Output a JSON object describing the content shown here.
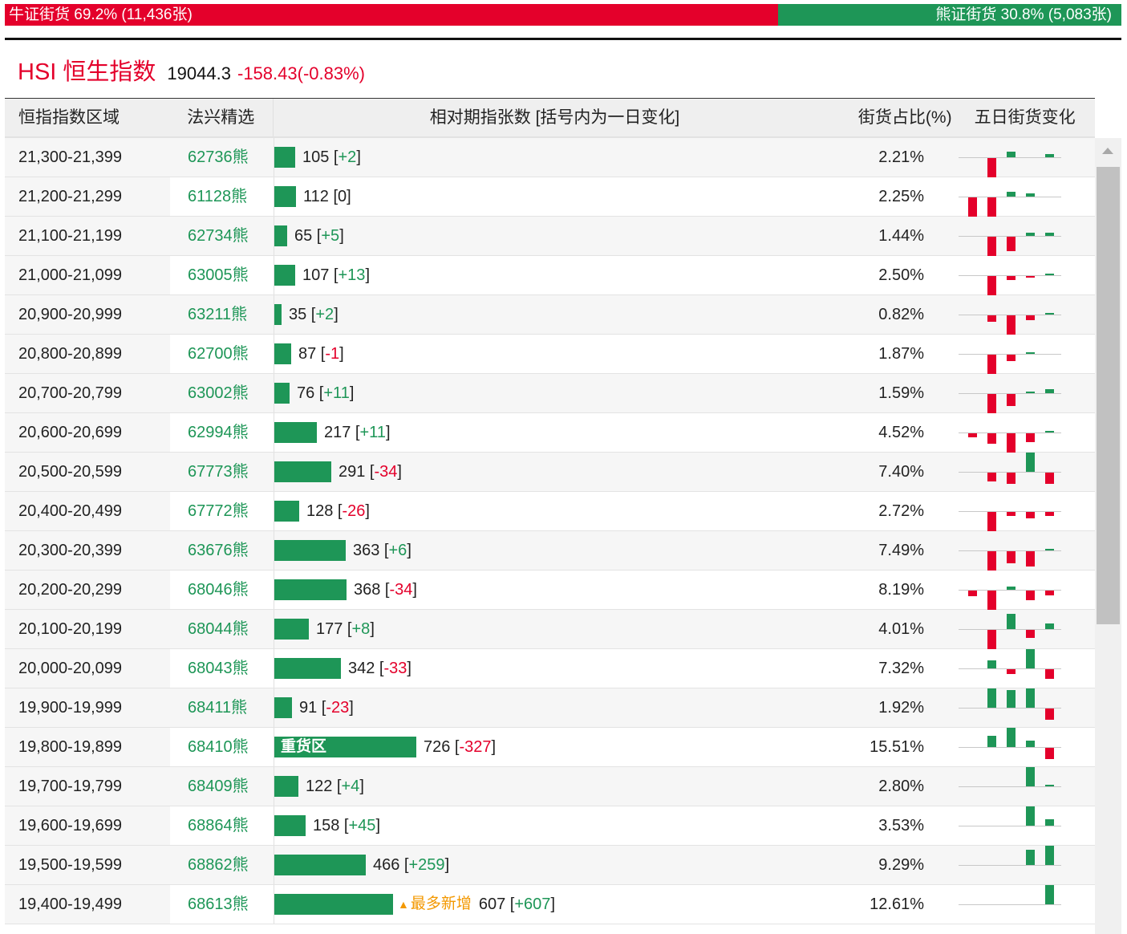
{
  "topbar": {
    "bull": "牛证街货 69.2% (11,436张)",
    "bear": "熊证街货 30.8% (5,083张)",
    "bull_pct": 69.2
  },
  "title": {
    "name": "HSI 恒生指数",
    "price": "19044.3",
    "change": "-158.43(-0.83%)"
  },
  "headers": [
    "恒指指数区域",
    "法兴精选",
    "相对期指张数 [括号内为一日变化]",
    "街货占比(%)",
    "五日街货变化"
  ],
  "max_count": 726,
  "colors": {
    "red": "#e4002b",
    "green": "#1e9657",
    "orange": "#f39800"
  },
  "rows": [
    {
      "range": "21,300-21,399",
      "code": "62736熊",
      "count": 105,
      "count_text": "105",
      "change": "+2",
      "pct": "2.21%",
      "five": [
        0,
        -1,
        0.3,
        0,
        0.15
      ]
    },
    {
      "range": "21,200-21,299",
      "code": "61128熊",
      "count": 112,
      "count_text": "112",
      "change": "0",
      "pct": "2.25%",
      "five": [
        -1,
        -1,
        0.25,
        0.15,
        0
      ]
    },
    {
      "range": "21,100-21,199",
      "code": "62734熊",
      "count": 65,
      "count_text": "65",
      "change": "+5",
      "pct": "1.44%",
      "five": [
        0,
        -1,
        -0.75,
        0.15,
        0.15
      ]
    },
    {
      "range": "21,000-21,099",
      "code": "63005熊",
      "count": 107,
      "count_text": "107",
      "change": "+13",
      "pct": "2.50%",
      "five": [
        0,
        -1,
        -0.2,
        -0.1,
        0.08
      ]
    },
    {
      "range": "20,900-20,999",
      "code": "63211熊",
      "count": 35,
      "count_text": "35",
      "change": "+2",
      "pct": "0.82%",
      "five": [
        0,
        -0.33,
        -1,
        -0.25,
        0.08
      ]
    },
    {
      "range": "20,800-20,899",
      "code": "62700熊",
      "count": 87,
      "count_text": "87",
      "change": "-1",
      "pct": "1.87%",
      "five": [
        0,
        -1,
        -0.33,
        0.08,
        0
      ]
    },
    {
      "range": "20,700-20,799",
      "code": "63002熊",
      "count": 76,
      "count_text": "76",
      "change": "+11",
      "pct": "1.59%",
      "five": [
        0,
        -1,
        -0.62,
        0.08,
        0.2
      ]
    },
    {
      "range": "20,600-20,699",
      "code": "62994熊",
      "count": 217,
      "count_text": "217",
      "change": "+11",
      "pct": "4.52%",
      "five": [
        -0.2,
        -0.55,
        -1,
        -0.45,
        0.08
      ]
    },
    {
      "range": "20,500-20,599",
      "code": "67773熊",
      "count": 291,
      "count_text": "291",
      "change": "-34",
      "pct": "7.40%",
      "five": [
        0,
        -0.45,
        -0.6,
        1,
        -0.6
      ]
    },
    {
      "range": "20,400-20,499",
      "code": "67772熊",
      "count": 128,
      "count_text": "128",
      "change": "-26",
      "pct": "2.72%",
      "five": [
        0,
        -1,
        -0.2,
        -0.33,
        -0.2
      ]
    },
    {
      "range": "20,300-20,399",
      "code": "63676熊",
      "count": 363,
      "count_text": "363",
      "change": "+6",
      "pct": "7.49%",
      "five": [
        0,
        -1,
        -0.62,
        -0.78,
        0.1
      ]
    },
    {
      "range": "20,200-20,299",
      "code": "68046熊",
      "count": 368,
      "count_text": "368",
      "change": "-34",
      "pct": "8.19%",
      "five": [
        -0.3,
        -1,
        0.15,
        -0.5,
        -0.25
      ]
    },
    {
      "range": "20,100-20,199",
      "code": "68044熊",
      "count": 177,
      "count_text": "177",
      "change": "+8",
      "pct": "4.01%",
      "five": [
        0,
        -1,
        0.8,
        -0.42,
        0.3
      ]
    },
    {
      "range": "20,000-20,099",
      "code": "68043熊",
      "count": 342,
      "count_text": "342",
      "change": "-33",
      "pct": "7.32%",
      "five": [
        0,
        0.42,
        -0.25,
        1,
        -0.5
      ]
    },
    {
      "range": "19,900-19,999",
      "code": "68411熊",
      "count": 91,
      "count_text": "91",
      "change": "-23",
      "pct": "1.92%",
      "five": [
        0,
        1,
        0.92,
        1,
        -0.6
      ]
    },
    {
      "range": "19,800-19,899",
      "code": "68410熊",
      "count": 726,
      "count_text": "726",
      "change": "-327",
      "pct": "15.51%",
      "bar_label": "重货区",
      "five": [
        0,
        0.6,
        1,
        0.33,
        -0.6
      ]
    },
    {
      "range": "19,700-19,799",
      "code": "68409熊",
      "count": 122,
      "count_text": "122",
      "change": "+4",
      "pct": "2.80%",
      "five": [
        0,
        0,
        0,
        1,
        0.08
      ]
    },
    {
      "range": "19,600-19,699",
      "code": "68864熊",
      "count": 158,
      "count_text": "158",
      "change": "+45",
      "pct": "3.53%",
      "five": [
        0,
        0,
        0,
        1,
        0.33
      ]
    },
    {
      "range": "19,500-19,599",
      "code": "68862熊",
      "count": 466,
      "count_text": "466",
      "change": "+259",
      "pct": "9.29%",
      "five": [
        0,
        0,
        0,
        0.8,
        1
      ]
    },
    {
      "range": "19,400-19,499",
      "code": "68613熊",
      "count": 607,
      "count_text": "607",
      "change": "+607",
      "pct": "12.61%",
      "tag": "最多新增",
      "five": [
        0,
        0,
        0,
        0,
        1
      ]
    }
  ]
}
